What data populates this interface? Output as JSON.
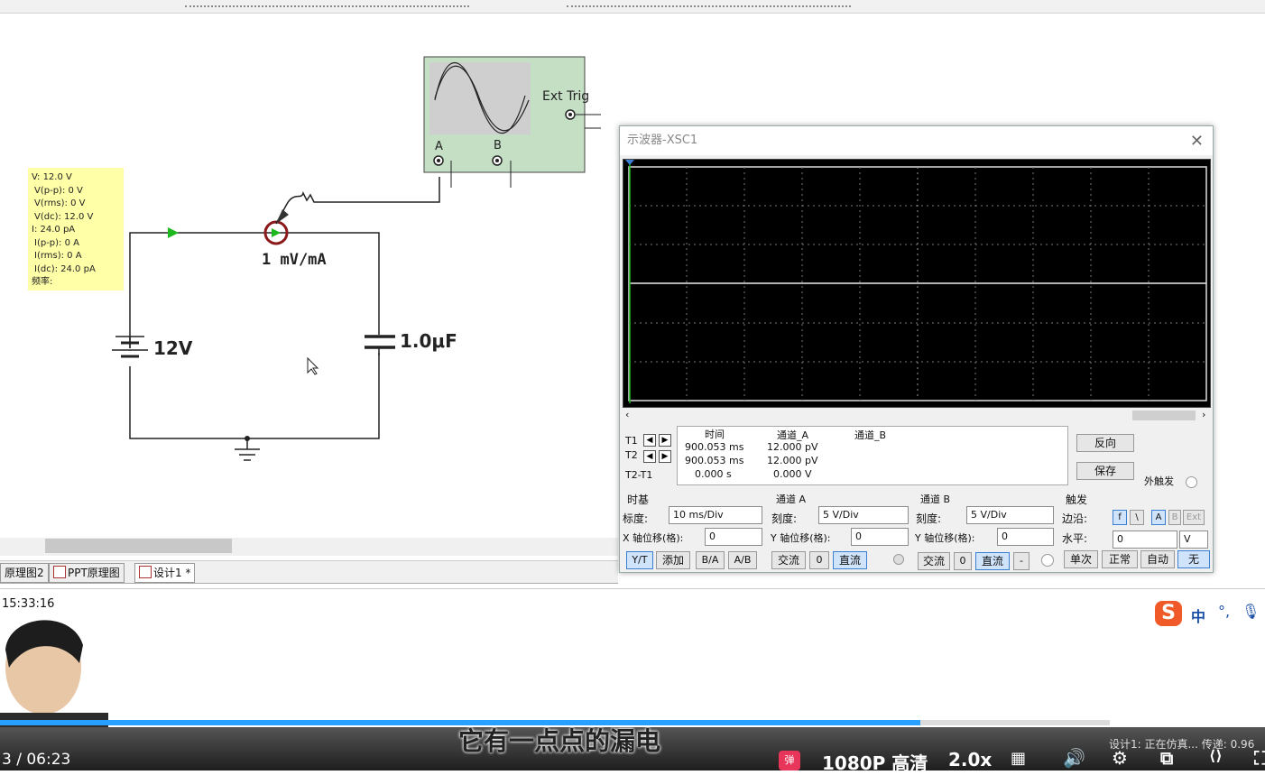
{
  "schematic": {
    "probe_label": {
      "lines": [
        "V: 12.0 V",
        "V(p-p): 0 V",
        "V(rms): 0 V",
        "V(dc): 12.0 V",
        "I: 24.0 pA",
        "I(p-p): 0 A",
        "I(rms): 0 A",
        "I(dc): 24.0 pA",
        "频率:"
      ]
    },
    "current_probe_text": "1  mV/mA",
    "battery_label": "12V",
    "capacitor_label": "1.0μF",
    "scope_ext_trig": "Ext Trig",
    "scope_a": "A",
    "scope_b": "B"
  },
  "tabs": [
    {
      "label": "原理图2"
    },
    {
      "label": "PPT原理图"
    },
    {
      "label": "设计1 *"
    }
  ],
  "clock": "15:33:16",
  "scope": {
    "title": "示波器-XSC1",
    "readout": {
      "headers": [
        "时间",
        "通道_A",
        "通道_B"
      ],
      "rows": [
        {
          "label": "T1",
          "time": "900.053 ms",
          "a": "12.000 pV",
          "b": ""
        },
        {
          "label": "T2",
          "time": "900.053 ms",
          "a": "12.000 pV",
          "b": ""
        },
        {
          "label": "T2-T1",
          "time": "0.000 s",
          "a": "0.000 V",
          "b": ""
        }
      ]
    },
    "reverse_btn": "反向",
    "save_btn": "保存",
    "ext_trigger": "外触发",
    "timebase": {
      "title": "时基",
      "scale_label": "标度:",
      "scale_value": "10 ms/Div",
      "xpos_label": "X 轴位移(格):",
      "xpos_value": "0",
      "buttons": [
        "Y/T",
        "添加",
        "B/A",
        "A/B"
      ]
    },
    "channel_a": {
      "title": "通道 A",
      "scale_label": "刻度:",
      "scale_value": "5  V/Div",
      "ypos_label": "Y 轴位移(格):",
      "ypos_value": "0",
      "buttons": [
        "交流",
        "0",
        "直流"
      ]
    },
    "channel_b": {
      "title": "通道 B",
      "scale_label": "刻度:",
      "scale_value": "5  V/Div",
      "ypos_label": "Y 轴位移(格):",
      "ypos_value": "0",
      "buttons": [
        "交流",
        "0",
        "直流",
        "-"
      ]
    },
    "trigger": {
      "title": "触发",
      "edge_label": "边沿:",
      "edge_buttons": [
        "f",
        "\\",
        "A",
        "B",
        "Ext"
      ],
      "level_label": "水平:",
      "level_value": "0",
      "level_unit": "V",
      "mode_buttons": [
        "单次",
        "正常",
        "自动",
        "无"
      ]
    }
  },
  "video": {
    "subtitle": "它有一点点的漏电",
    "time": "3 / 06:23",
    "quality": "1080P 高清",
    "speed": "2.0x",
    "status_text": "设计1: 正在仿真... 传递: 0.96"
  },
  "ime": {
    "label": "中"
  }
}
